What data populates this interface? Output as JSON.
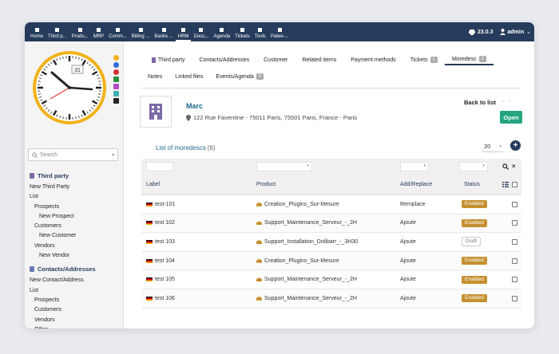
{
  "topbar": {
    "items": [
      {
        "label": "Home",
        "icon": "home-icon"
      },
      {
        "label": "Third p...",
        "icon": "building-icon"
      },
      {
        "label": "Produ...",
        "icon": "cube-icon"
      },
      {
        "label": "MRP",
        "icon": "cogs-icon"
      },
      {
        "label": "Comm...",
        "icon": "briefcase-icon"
      },
      {
        "label": "Billing ...",
        "icon": "invoice-icon"
      },
      {
        "label": "Banks ...",
        "icon": "bank-icon"
      },
      {
        "label": "HRM",
        "icon": "user-icon"
      },
      {
        "label": "Docu...",
        "icon": "folder-icon"
      },
      {
        "label": "Agenda",
        "icon": "calendar-icon"
      },
      {
        "label": "Tickets",
        "icon": "ticket-icon"
      },
      {
        "label": "Tools",
        "icon": "tools-icon"
      },
      {
        "label": "Patee-...",
        "icon": "hammer-icon"
      }
    ],
    "version": "23.0.3",
    "user": "admin"
  },
  "clock": {
    "day": "31"
  },
  "search": {
    "placeholder": "Search"
  },
  "menu": {
    "section1": "Third party",
    "s1items": [
      "New Third Party",
      "List"
    ],
    "s1sub": [
      "Prospects",
      "New Prospect",
      "Customers",
      "New Customer",
      "Vendors",
      "New Vendor"
    ],
    "section2": "Contacts/Addresses",
    "s2items": [
      "New Contact/Address",
      "List"
    ],
    "s2sub": [
      "Prospects",
      "Customers",
      "Vendors",
      "Other"
    ]
  },
  "tabs": [
    {
      "label": "Third party"
    },
    {
      "label": "Contacts/Addresses"
    },
    {
      "label": "Customer"
    },
    {
      "label": "Related items"
    },
    {
      "label": "Payment methods"
    },
    {
      "label": "Tickets",
      "count": "1"
    },
    {
      "label": "Moredesc",
      "count": "2"
    }
  ],
  "tabs2": [
    {
      "label": "Notes"
    },
    {
      "label": "Linked files"
    },
    {
      "label": "Events/Agenda",
      "count": "0"
    }
  ],
  "company": {
    "name": "Marc",
    "address": "122 Rue Faventine - 75011 Paris, 75501 Paris, France - Paris"
  },
  "back_to_list": "Back to list",
  "open_label": "Open",
  "list": {
    "title": "List of moredescs",
    "count": "(6)",
    "page_size": "20"
  },
  "table": {
    "headers": [
      "Label",
      "Product",
      "Add/Replace",
      "Status"
    ],
    "rows": [
      {
        "label": "test-101",
        "product": "Creation_Plugins_Sur-Mesure",
        "mode": "Remplace",
        "status": "Enabled"
      },
      {
        "label": "test 102",
        "product": "Support_Maintenance_Serveur_-_2H",
        "mode": "Ajoute",
        "status": "Enabled"
      },
      {
        "label": "test 103",
        "product": "Support_Installation_Dolibarr_-_3H30",
        "mode": "Ajoute",
        "status": "Draft"
      },
      {
        "label": "test 104",
        "product": "Creation_Plugins_Sur-Mesure",
        "mode": "Ajoute",
        "status": "Enabled"
      },
      {
        "label": "test 105",
        "product": "Support_Maintenance_Serveur_-_2H",
        "mode": "Ajoute",
        "status": "Enabled"
      },
      {
        "label": "test 106",
        "product": "Support_Maintenance_Serveur_-_2H",
        "mode": "Ajoute",
        "status": "Enabled"
      }
    ]
  }
}
